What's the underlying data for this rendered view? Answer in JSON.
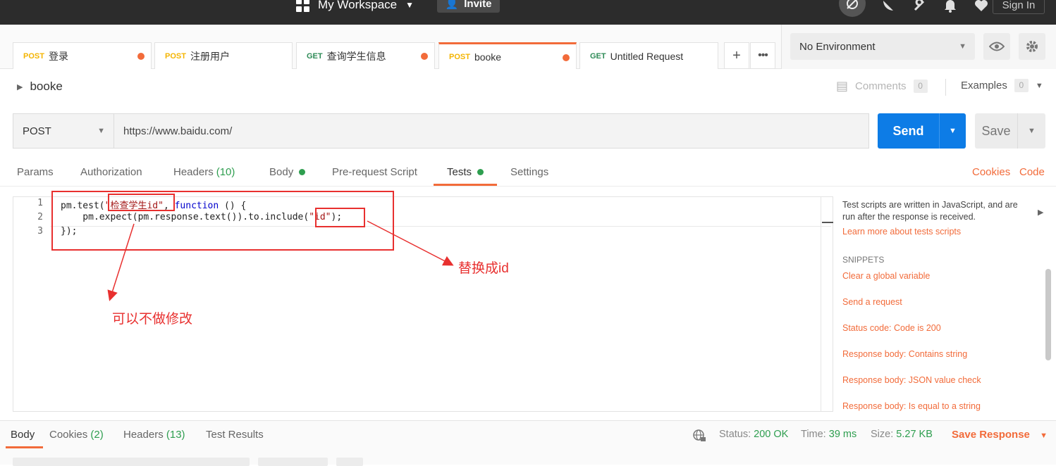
{
  "topbar": {
    "workspace_label": "My Workspace",
    "invite_label": "Invite",
    "signin_label": "Sign In",
    "icons": [
      "sync-off-icon",
      "satellite-icon",
      "wrench-icon",
      "bell-icon",
      "heart-icon"
    ]
  },
  "tabs": [
    {
      "method": "POST",
      "name": "登录",
      "unsaved": true
    },
    {
      "method": "POST",
      "name": "注册用户",
      "unsaved": false
    },
    {
      "method": "GET",
      "name": "查询学生信息",
      "unsaved": true
    },
    {
      "method": "POST",
      "name": "booke",
      "unsaved": true,
      "active": true
    },
    {
      "method": "GET",
      "name": "Untitled Request",
      "unsaved": false
    }
  ],
  "environment": {
    "selected": "No Environment"
  },
  "request": {
    "name": "booke",
    "comments_label": "Comments",
    "comments_count": "0",
    "examples_label": "Examples",
    "examples_count": "0",
    "method": "POST",
    "url": "https://www.baidu.com/",
    "send_label": "Send",
    "save_label": "Save"
  },
  "subtabs": {
    "params": "Params",
    "authorization": "Authorization",
    "headers": "Headers",
    "headers_count": "(10)",
    "body": "Body",
    "prerequest": "Pre-request Script",
    "tests": "Tests",
    "settings": "Settings",
    "cookies": "Cookies",
    "code": "Code"
  },
  "editor": {
    "line_numbers": [
      "1",
      "2",
      "3"
    ],
    "l1_a": "pm.test(",
    "l1_str": "\"检查学生id\"",
    "l1_b": ", ",
    "l1_kw": "function",
    "l1_c": " () {",
    "l2_a": "    pm.expect(pm.response.text()).to.include(",
    "l2_str": "\"id\"",
    "l2_b": ");",
    "l3": "});"
  },
  "annotations": {
    "replace_note": "替换成id",
    "optional_note": "可以不做修改"
  },
  "snippets_panel": {
    "description": "Test scripts are written in JavaScript, and are run after the response is received.",
    "learn_more": "Learn more about tests scripts",
    "heading": "SNIPPETS",
    "items": [
      "Clear a global variable",
      "Send a request",
      "Status code: Code is 200",
      "Response body: Contains string",
      "Response body: JSON value check",
      "Response body: Is equal to a string"
    ]
  },
  "response_bar": {
    "body": "Body",
    "cookies": "Cookies",
    "cookies_count": "(2)",
    "headers": "Headers",
    "headers_count": "(13)",
    "test_results": "Test Results",
    "status_label": "Status:",
    "status_value": "200 OK",
    "time_label": "Time:",
    "time_value": "39 ms",
    "size_label": "Size:",
    "size_value": "5.27 KB",
    "save_response": "Save Response"
  },
  "colors": {
    "accent": "#f26b3a",
    "send": "#0d7ce6",
    "success": "#2e9e4f",
    "annotation": "#e8302f"
  }
}
